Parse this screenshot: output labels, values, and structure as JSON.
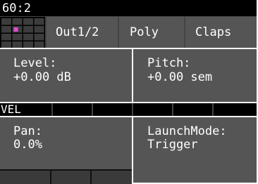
{
  "top_bar": {
    "label": "60:2"
  },
  "header": {
    "grid_cells": [
      [
        0,
        0,
        0,
        0
      ],
      [
        0,
        1,
        0,
        0
      ],
      [
        0,
        0,
        0,
        0
      ],
      [
        0,
        0,
        0,
        0
      ]
    ],
    "grid_active_color": "#e04fd0",
    "tabs": [
      "Out1/2",
      "Poly",
      "Claps"
    ]
  },
  "params_top": [
    {
      "name": "Level:",
      "value": "+0.00 dB"
    },
    {
      "name": "Pitch:",
      "value": "+0.00 sem"
    }
  ],
  "vel_bar": {
    "label": "VEL"
  },
  "params_bottom": [
    {
      "name": "Pan:",
      "value": "0.0%"
    },
    {
      "name": "LaunchMode:",
      "value": "Trigger"
    }
  ],
  "colors": {
    "background": "#000000",
    "panel": "#555555",
    "panel_dark": "#1a1a1a",
    "text": "#ffffff"
  }
}
